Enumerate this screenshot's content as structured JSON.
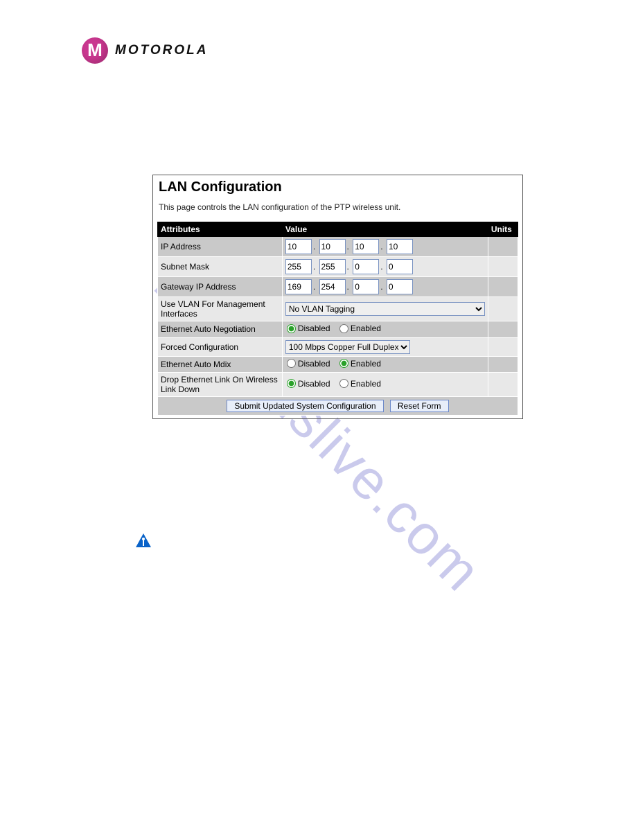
{
  "logo_text": "MOTOROLA",
  "watermark": "manualslive.com",
  "panel": {
    "title": "LAN Configuration",
    "description": "This page controls the LAN configuration of the PTP wireless unit.",
    "headers": {
      "attr": "Attributes",
      "value": "Value",
      "units": "Units"
    },
    "rows": {
      "ip_address": {
        "label": "IP Address",
        "o1": "10",
        "o2": "10",
        "o3": "10",
        "o4": "10"
      },
      "subnet_mask": {
        "label": "Subnet Mask",
        "o1": "255",
        "o2": "255",
        "o3": "0",
        "o4": "0"
      },
      "gateway": {
        "label": "Gateway IP Address",
        "o1": "169",
        "o2": "254",
        "o3": "0",
        "o4": "0"
      },
      "vlan": {
        "label": "Use VLAN For Management Interfaces",
        "value": "No VLAN Tagging"
      },
      "eth_auto_neg": {
        "label": "Ethernet Auto Negotiation",
        "disabled": "Disabled",
        "enabled": "Enabled",
        "selected": "disabled"
      },
      "forced_cfg": {
        "label": "Forced Configuration",
        "value": "100 Mbps Copper Full Duplex"
      },
      "eth_auto_mdix": {
        "label": "Ethernet Auto Mdix",
        "disabled": "Disabled",
        "enabled": "Enabled",
        "selected": "enabled"
      },
      "drop_link": {
        "label": "Drop Ethernet Link On Wireless Link Down",
        "disabled": "Disabled",
        "enabled": "Enabled",
        "selected": "disabled"
      }
    },
    "buttons": {
      "submit": "Submit Updated System Configuration",
      "reset": "Reset Form"
    }
  }
}
